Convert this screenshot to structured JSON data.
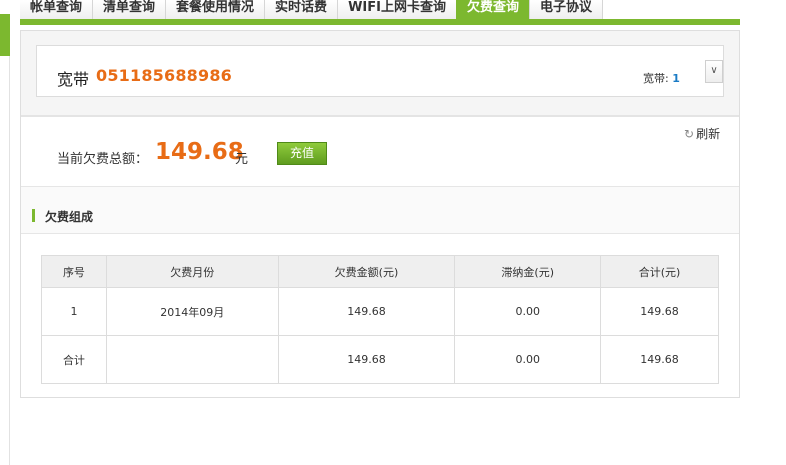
{
  "tabs": [
    "帐单查询",
    "清单查询",
    "套餐使用情况",
    "实时话费",
    "WIFI上网卡查询",
    "欠费查询",
    "电子协议"
  ],
  "active_tab": "欠费查询",
  "account": {
    "type": "宽带",
    "number": "051185688986",
    "count_label": "宽带:",
    "count": "1"
  },
  "refresh_label": "刷新",
  "arrears": {
    "label": "当前欠费总额：",
    "amount": "149.68",
    "unit": "元",
    "recharge_label": "充值"
  },
  "section_title": "欠费组成",
  "table": {
    "headers": [
      "序号",
      "欠费月份",
      "欠费金额(元)",
      "滞纳金(元)",
      "合计(元)"
    ],
    "rows": [
      [
        "1",
        "2014年09月",
        "149.68",
        "0.00",
        "149.68"
      ],
      [
        "合计",
        "",
        "149.68",
        "0.00",
        "149.68"
      ]
    ]
  },
  "colors": {
    "accent_green": "#7cb82f",
    "amount_orange": "#e86c16",
    "count_blue": "#1a7bc5"
  }
}
